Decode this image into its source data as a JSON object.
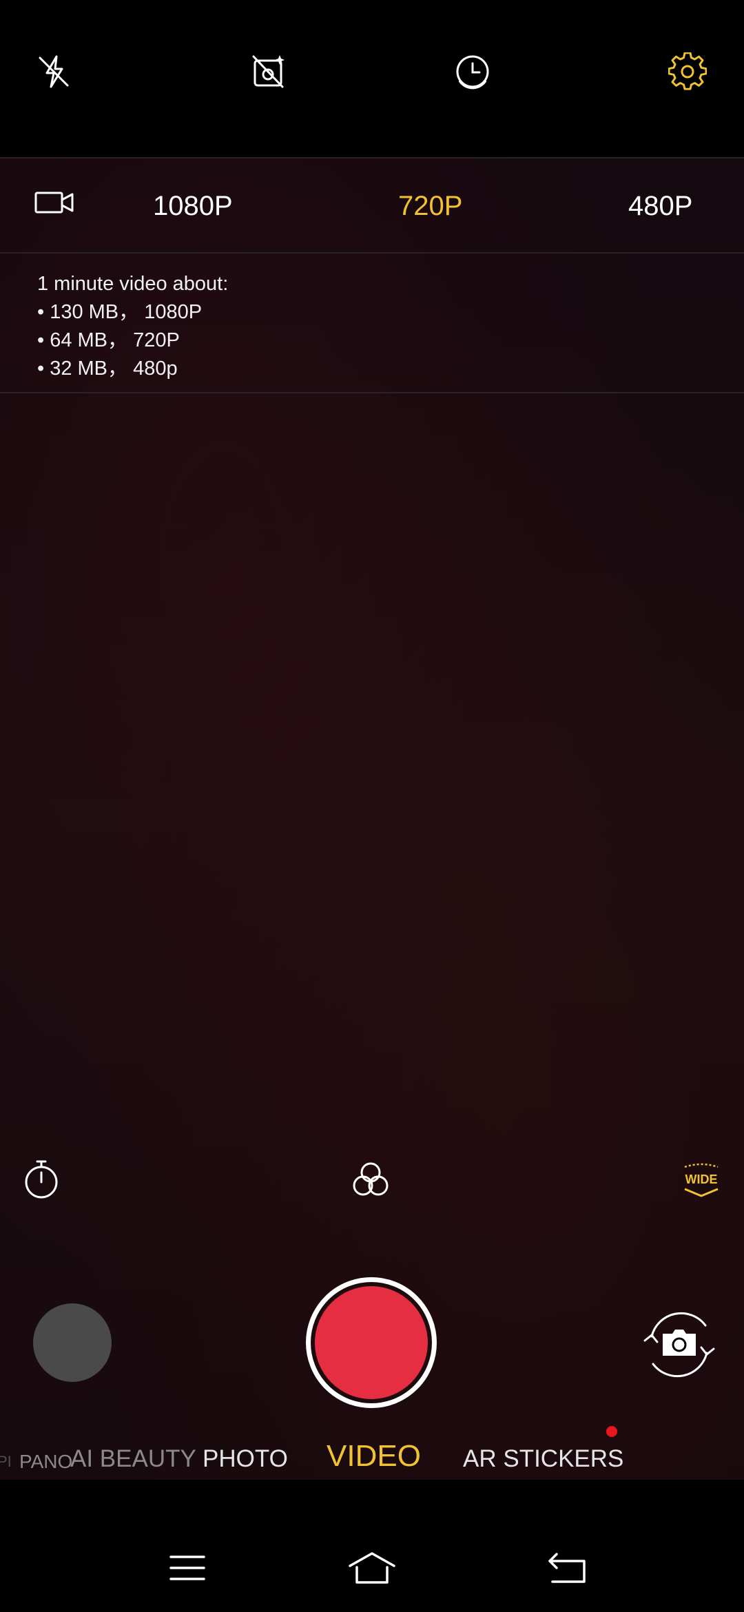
{
  "colors": {
    "accent": "#f1c232",
    "record": "#e62e43",
    "notification_dot": "#e8161f"
  },
  "top_bar": {
    "icons": [
      "flash-off-icon",
      "ai-scene-off-icon",
      "motion-photo-icon",
      "settings-icon"
    ]
  },
  "resolution": {
    "icon": "video-camera-icon",
    "options": [
      "1080P",
      "720P",
      "480P"
    ],
    "selected": "720P"
  },
  "info": {
    "lines": [
      "1 minute video about:",
      "• 130 MB， 1080P",
      "• 64 MB， 720P",
      "• 32 MB， 480p"
    ]
  },
  "controls": {
    "icons": [
      "timer-icon",
      "filters-icon",
      "wide-angle-icon"
    ],
    "wide_label": "WIDE"
  },
  "modes": {
    "items": [
      "PANO",
      "AI BEAUTY",
      "PHOTO",
      "VIDEO",
      "AR STICKERS"
    ],
    "active": "VIDEO"
  },
  "nav": {
    "icons": [
      "menu-icon",
      "home-icon",
      "back-icon"
    ]
  }
}
